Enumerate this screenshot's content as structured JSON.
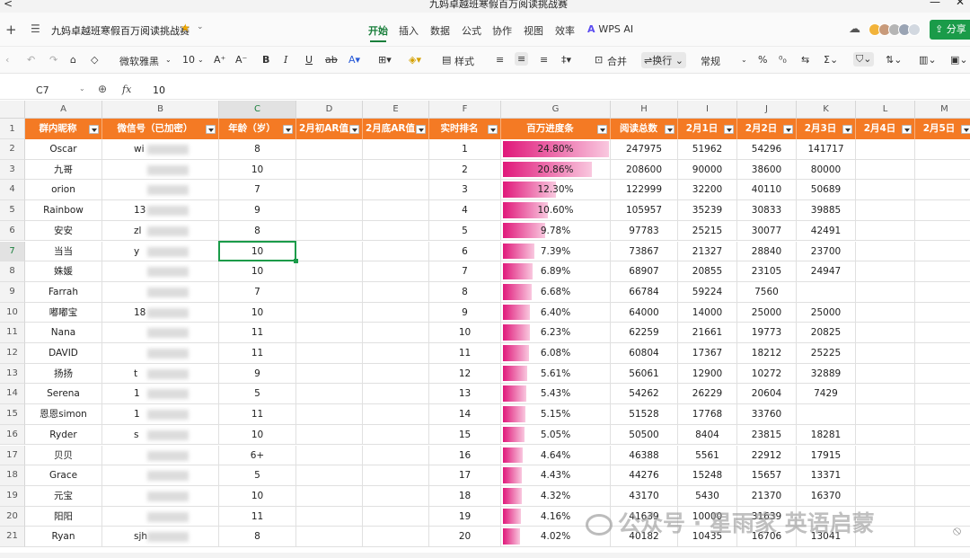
{
  "window": {
    "title": "九妈卓越班寒假百万阅读挑战赛",
    "back": "<",
    "minimize": "—",
    "close": "✕"
  },
  "menubar": {
    "new_tab": "+",
    "menu_icon": "☰",
    "doc_title": "九妈卓越班寒假百万阅读挑战赛",
    "star": "★",
    "tabs": [
      "开始",
      "插入",
      "数据",
      "公式",
      "协作",
      "视图",
      "效率"
    ],
    "active_tab": "开始",
    "wps_ai": "WPS AI",
    "share": "分享"
  },
  "toolbar": {
    "font": "微软雅黑",
    "font_size": "10",
    "style": "样式",
    "merge": "合并",
    "wrap": "换行",
    "number_format": "常规",
    "percent": "%"
  },
  "formula_bar": {
    "cell_ref": "C7",
    "fx": "fx",
    "value": "10"
  },
  "columns": [
    "A",
    "B",
    "C",
    "D",
    "E",
    "F",
    "G",
    "H",
    "I",
    "J",
    "K",
    "L",
    "M"
  ],
  "selected_column": "C",
  "headers": [
    "群内昵称",
    "微信号（已加密）",
    "年龄（岁）",
    "2月初AR值",
    "2月底AR值",
    "实时排名",
    "百万进度条",
    "阅读总数",
    "2月1日",
    "2月2日",
    "2月3日",
    "2月4日",
    "2月5日"
  ],
  "header_color": "#f47a24",
  "bar_color": "#e0187a",
  "rows": [
    {
      "row": "2",
      "name": "Oscar",
      "wechat": "wi",
      "age": "8",
      "rank": "1",
      "progress_pct": 24.8,
      "progress": "24.80%",
      "total": "247975",
      "d1": "51962",
      "d2": "54296",
      "d3": "141717"
    },
    {
      "row": "3",
      "name": "九哥",
      "wechat": "",
      "age": "10",
      "rank": "2",
      "progress_pct": 20.86,
      "progress": "20.86%",
      "total": "208600",
      "d1": "90000",
      "d2": "38600",
      "d3": "80000"
    },
    {
      "row": "4",
      "name": "orion",
      "wechat": "",
      "age": "7",
      "rank": "3",
      "progress_pct": 12.3,
      "progress": "12.30%",
      "total": "122999",
      "d1": "32200",
      "d2": "40110",
      "d3": "50689"
    },
    {
      "row": "5",
      "name": "Rainbow",
      "wechat": "13",
      "age": "9",
      "rank": "4",
      "progress_pct": 10.6,
      "progress": "10.60%",
      "total": "105957",
      "d1": "35239",
      "d2": "30833",
      "d3": "39885"
    },
    {
      "row": "6",
      "name": "安安",
      "wechat": "zl",
      "age": "8",
      "rank": "5",
      "progress_pct": 9.78,
      "progress": "9.78%",
      "total": "97783",
      "d1": "25215",
      "d2": "30077",
      "d3": "42491"
    },
    {
      "row": "7",
      "name": "当当",
      "wechat": "y",
      "age": "10",
      "rank": "6",
      "progress_pct": 7.39,
      "progress": "7.39%",
      "total": "73867",
      "d1": "21327",
      "d2": "28840",
      "d3": "23700"
    },
    {
      "row": "8",
      "name": "姝媛",
      "wechat": "",
      "age": "10",
      "rank": "7",
      "progress_pct": 6.89,
      "progress": "6.89%",
      "total": "68907",
      "d1": "20855",
      "d2": "23105",
      "d3": "24947"
    },
    {
      "row": "9",
      "name": "Farrah",
      "wechat": "",
      "age": "7",
      "rank": "8",
      "progress_pct": 6.68,
      "progress": "6.68%",
      "total": "66784",
      "d1": "59224",
      "d2": "7560",
      "d3": ""
    },
    {
      "row": "10",
      "name": "嘟嘟宝",
      "wechat": "18",
      "age": "10",
      "rank": "9",
      "progress_pct": 6.4,
      "progress": "6.40%",
      "total": "64000",
      "d1": "14000",
      "d2": "25000",
      "d3": "25000"
    },
    {
      "row": "11",
      "name": "Nana",
      "wechat": "",
      "age": "11",
      "rank": "10",
      "progress_pct": 6.23,
      "progress": "6.23%",
      "total": "62259",
      "d1": "21661",
      "d2": "19773",
      "d3": "20825"
    },
    {
      "row": "12",
      "name": "DAVID",
      "wechat": "",
      "age": "11",
      "rank": "11",
      "progress_pct": 6.08,
      "progress": "6.08%",
      "total": "60804",
      "d1": "17367",
      "d2": "18212",
      "d3": "25225"
    },
    {
      "row": "13",
      "name": "扬扬",
      "wechat": "t",
      "age": "9",
      "rank": "12",
      "progress_pct": 5.61,
      "progress": "5.61%",
      "total": "56061",
      "d1": "12900",
      "d2": "10272",
      "d3": "32889"
    },
    {
      "row": "14",
      "name": "Serena",
      "wechat": "1",
      "age": "5",
      "rank": "13",
      "progress_pct": 5.43,
      "progress": "5.43%",
      "total": "54262",
      "d1": "26229",
      "d2": "20604",
      "d3": "7429"
    },
    {
      "row": "15",
      "name": "恩恩simon",
      "wechat": "1",
      "age": "11",
      "rank": "14",
      "progress_pct": 5.15,
      "progress": "5.15%",
      "total": "51528",
      "d1": "17768",
      "d2": "33760",
      "d3": ""
    },
    {
      "row": "16",
      "name": "Ryder",
      "wechat": "s",
      "age": "10",
      "rank": "15",
      "progress_pct": 5.05,
      "progress": "5.05%",
      "total": "50500",
      "d1": "8404",
      "d2": "23815",
      "d3": "18281"
    },
    {
      "row": "17",
      "name": "贝贝",
      "wechat": "",
      "age": "6+",
      "rank": "16",
      "progress_pct": 4.64,
      "progress": "4.64%",
      "total": "46388",
      "d1": "5561",
      "d2": "22912",
      "d3": "17915"
    },
    {
      "row": "18",
      "name": "Grace",
      "wechat": "",
      "age": "5",
      "rank": "17",
      "progress_pct": 4.43,
      "progress": "4.43%",
      "total": "44276",
      "d1": "15248",
      "d2": "15657",
      "d3": "13371"
    },
    {
      "row": "19",
      "name": "元宝",
      "wechat": "",
      "age": "10",
      "rank": "18",
      "progress_pct": 4.32,
      "progress": "4.32%",
      "total": "43170",
      "d1": "5430",
      "d2": "21370",
      "d3": "16370"
    },
    {
      "row": "20",
      "name": "阳阳",
      "wechat": "",
      "age": "11",
      "rank": "19",
      "progress_pct": 4.16,
      "progress": "4.16%",
      "total": "41639",
      "d1": "10000",
      "d2": "31639",
      "d3": ""
    },
    {
      "row": "21",
      "name": "Ryan",
      "wechat": "sjh",
      "age": "8",
      "rank": "20",
      "progress_pct": 4.02,
      "progress": "4.02%",
      "total": "40182",
      "d1": "10435",
      "d2": "16706",
      "d3": "13041"
    }
  ],
  "selected_cell": {
    "row": "7",
    "col": "C"
  },
  "watermark": "公众号 · 星雨家 英语启蒙"
}
